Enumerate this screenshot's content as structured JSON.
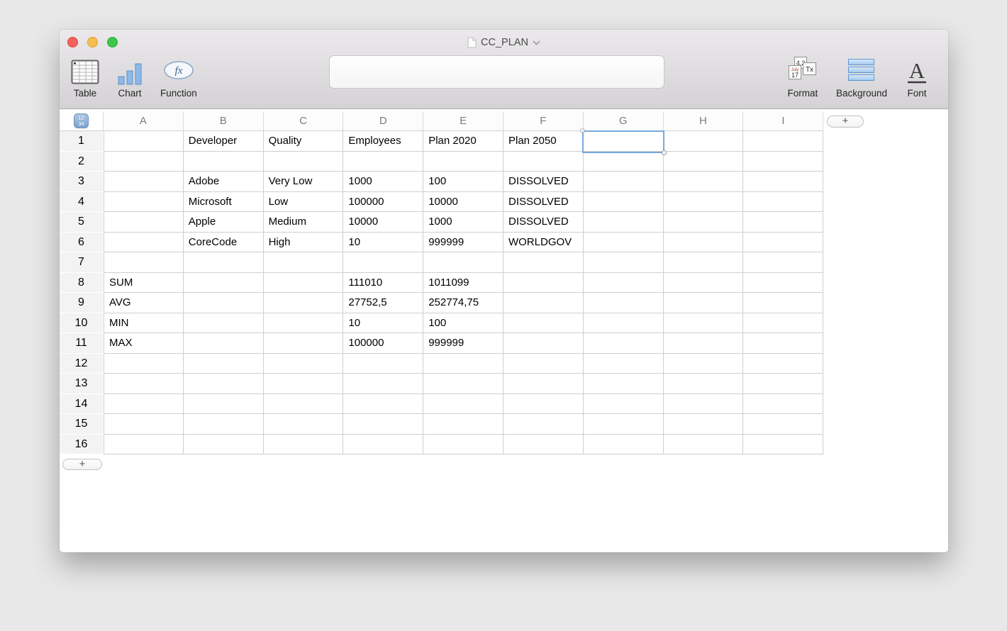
{
  "window": {
    "title": "CC_PLAN",
    "traffic_lights": [
      "close",
      "minimize",
      "zoom"
    ]
  },
  "toolbar": {
    "left": [
      {
        "label": "Table",
        "icon": "table-icon"
      },
      {
        "label": "Chart",
        "icon": "bar-chart-icon"
      },
      {
        "label": "Function",
        "icon": "fx-icon"
      }
    ],
    "right": [
      {
        "label": "Format",
        "icon": "format-tiles-icon"
      },
      {
        "label": "Background",
        "icon": "background-bars-icon"
      },
      {
        "label": "Font",
        "icon": "font-a-icon"
      }
    ],
    "formula_bar_value": ""
  },
  "spreadsheet": {
    "columns": [
      "A",
      "B",
      "C",
      "D",
      "E",
      "F",
      "G",
      "H",
      "I"
    ],
    "row_count": 16,
    "selected_cell": {
      "column": "G",
      "row": 1
    },
    "add_column_label": "+",
    "add_row_label": "+",
    "corner_icon": "12 34",
    "rows": [
      [
        "",
        "Developer",
        "Quality",
        "Employees",
        "Plan 2020",
        "Plan 2050",
        "",
        "",
        ""
      ],
      [
        "",
        "",
        "",
        "",
        "",
        "",
        "",
        "",
        ""
      ],
      [
        "",
        "Adobe",
        "Very Low",
        "1000",
        "100",
        "DISSOLVED",
        "",
        "",
        ""
      ],
      [
        "",
        "Microsoft",
        "Low",
        "100000",
        "10000",
        "DISSOLVED",
        "",
        "",
        ""
      ],
      [
        "",
        "Apple",
        "Medium",
        "10000",
        "1000",
        "DISSOLVED",
        "",
        "",
        ""
      ],
      [
        "",
        "CoreCode",
        "High",
        "10",
        "999999",
        "WORLDGOV",
        "",
        "",
        ""
      ],
      [
        "",
        "",
        "",
        "",
        "",
        "",
        "",
        "",
        ""
      ],
      [
        "SUM",
        "",
        "",
        "111010",
        "1011099",
        "",
        "",
        "",
        ""
      ],
      [
        "AVG",
        "",
        "",
        "27752,5",
        "252774,75",
        "",
        "",
        "",
        ""
      ],
      [
        "MIN",
        "",
        "",
        "10",
        "100",
        "",
        "",
        "",
        ""
      ],
      [
        "MAX",
        "",
        "",
        "100000",
        "999999",
        "",
        "",
        "",
        ""
      ],
      [
        "",
        "",
        "",
        "",
        "",
        "",
        "",
        "",
        ""
      ],
      [
        "",
        "",
        "",
        "",
        "",
        "",
        "",
        "",
        ""
      ],
      [
        "",
        "",
        "",
        "",
        "",
        "",
        "",
        "",
        ""
      ],
      [
        "",
        "",
        "",
        "",
        "",
        "",
        "",
        "",
        ""
      ],
      [
        "",
        "",
        "",
        "",
        "",
        "",
        "",
        "",
        ""
      ]
    ]
  },
  "colors": {
    "selection_border": "#78aae1",
    "traffic_red": "#f5615c",
    "traffic_yellow": "#f5bd4f",
    "traffic_green": "#3ec74a",
    "grid_line": "#cfcfcf"
  }
}
